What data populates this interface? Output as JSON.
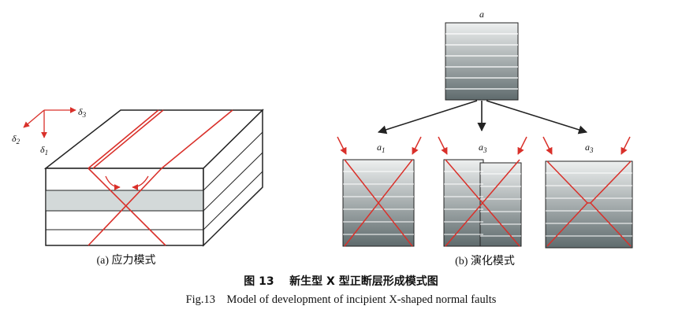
{
  "panel_a": {
    "label": "(a) 应力模式",
    "axes": {
      "delta_symbol": "δ",
      "sub1": "1",
      "sub2": "2",
      "sub3": "3"
    }
  },
  "panel_b": {
    "label": "(b) 演化模式",
    "stage_top": "a",
    "stage_symbol": "a",
    "stage_subs": [
      "1",
      "3",
      "3"
    ]
  },
  "caption": {
    "cn_number": "图 13",
    "cn_title": "新生型 X 型正断层形成模式图",
    "en_number": "Fig.13",
    "en_title": "Model of development of incipient X-shaped normal faults"
  },
  "colors": {
    "fault": "#d9302a",
    "outline": "#222222",
    "accent_layer": "#cfd6d6"
  }
}
